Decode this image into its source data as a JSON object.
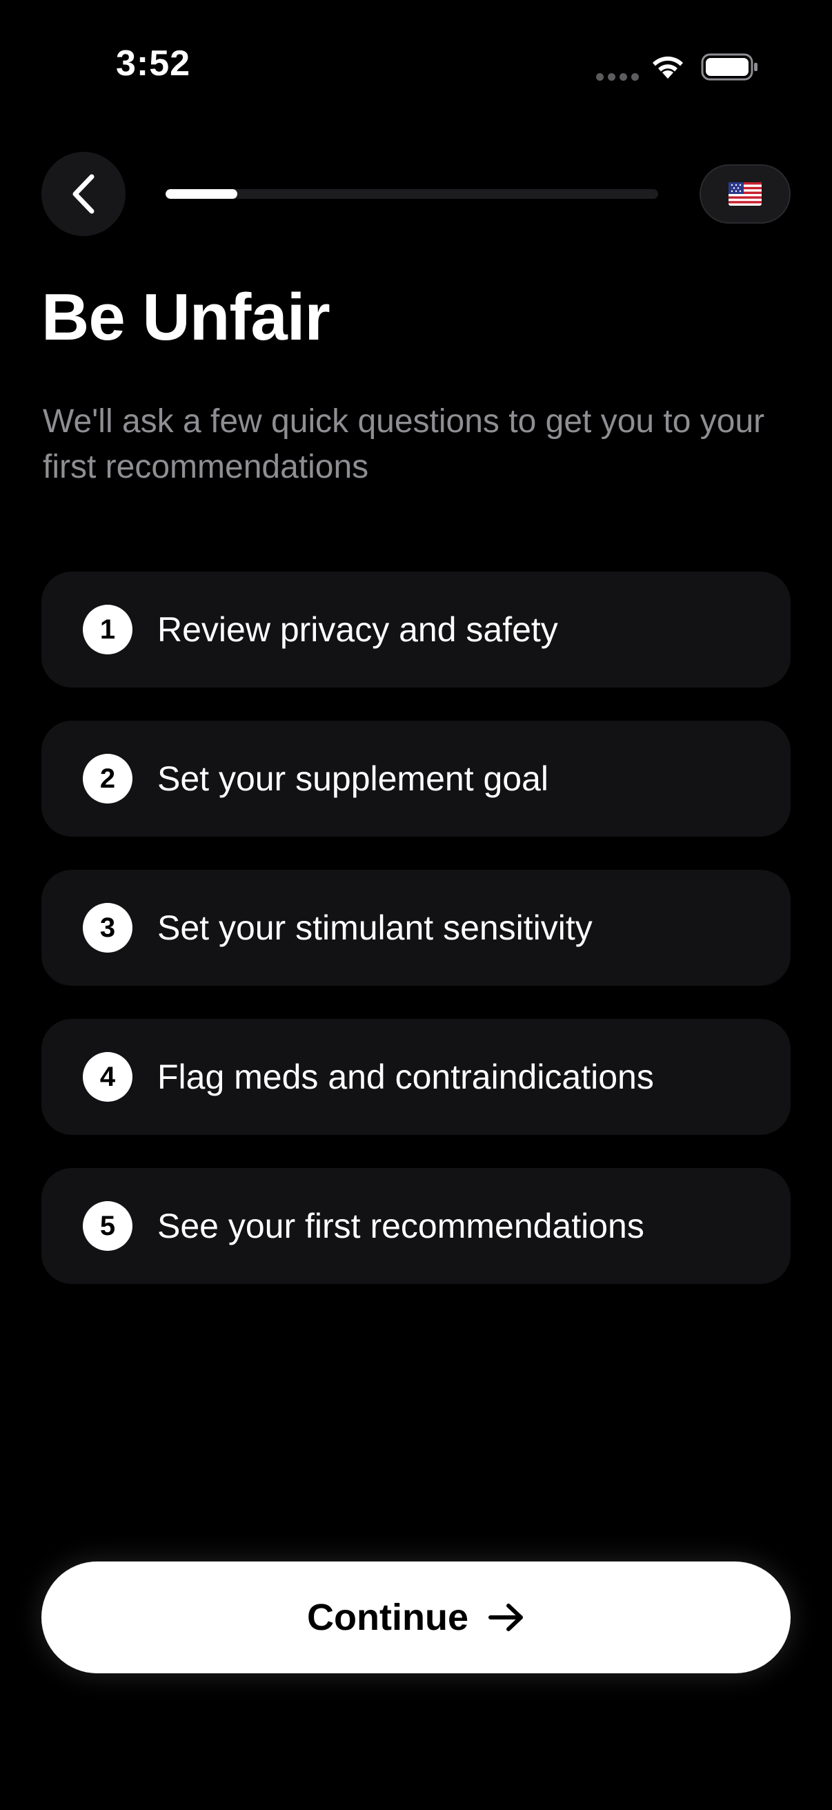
{
  "status_bar": {
    "time": "3:52"
  },
  "header": {
    "back_icon": "chevron-left-icon",
    "progress_fraction": 0.145,
    "language_flag": "us-flag-icon"
  },
  "main": {
    "title": "Be Unfair",
    "subtitle": "We'll ask a few quick questions to get you to your first recommendations",
    "steps": [
      {
        "number": "1",
        "label": "Review privacy and safety"
      },
      {
        "number": "2",
        "label": "Set your supplement goal"
      },
      {
        "number": "3",
        "label": "Set your stimulant sensitivity"
      },
      {
        "number": "4",
        "label": "Flag meds and contraindications"
      },
      {
        "number": "5",
        "label": "See your first recommendations"
      }
    ]
  },
  "footer": {
    "continue_label": "Continue",
    "continue_icon": "arrow-right-icon"
  },
  "colors": {
    "background": "#000000",
    "card": "#121214",
    "subtitle": "#8e8e93",
    "accent": "#ffffff"
  }
}
